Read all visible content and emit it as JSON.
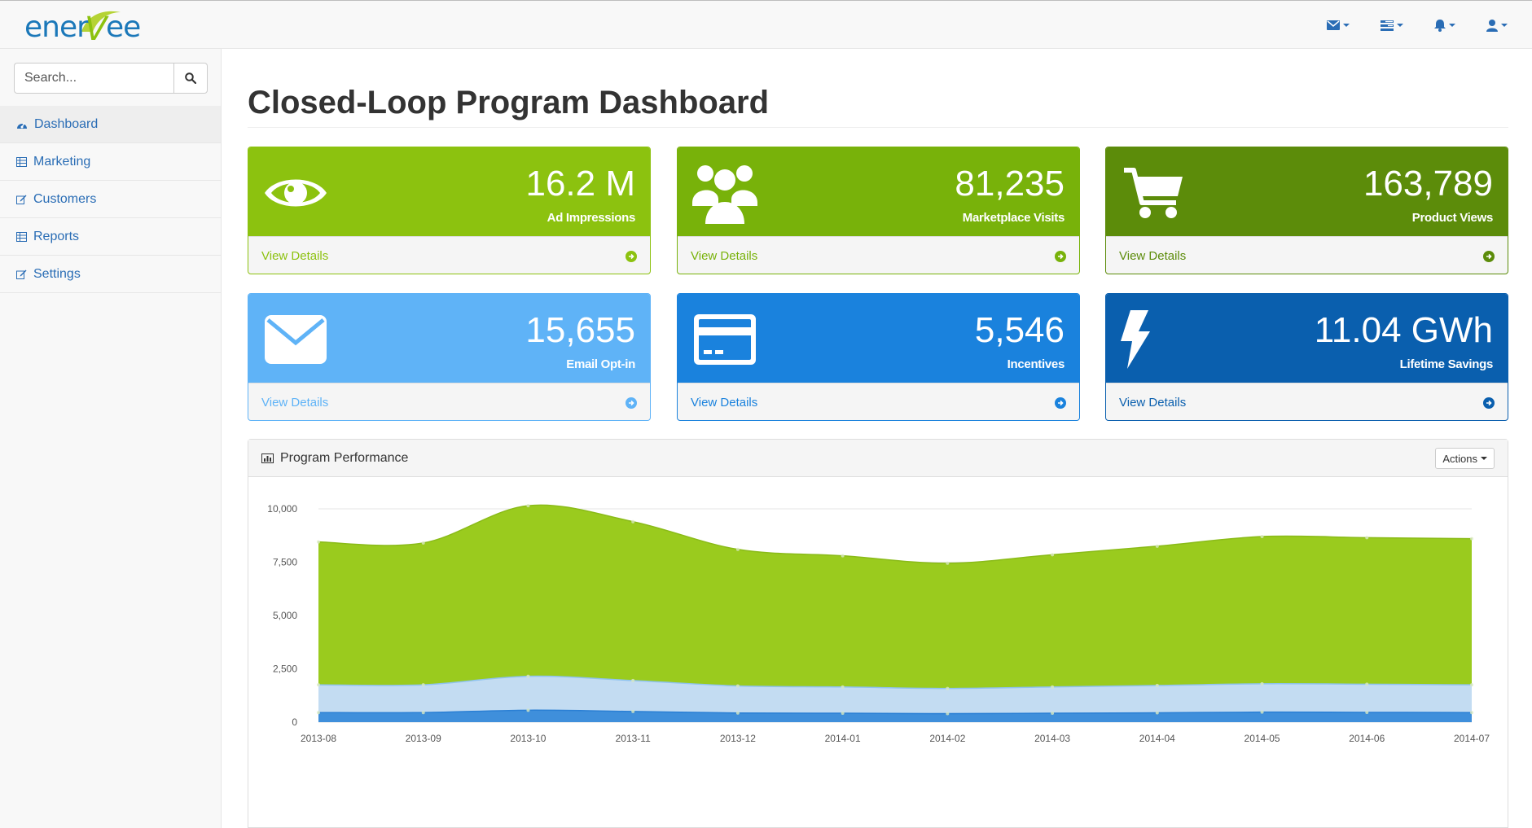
{
  "brand": {
    "logo_text": "enerVee"
  },
  "topbar": {
    "icons": [
      {
        "name": "envelope-icon"
      },
      {
        "name": "tasks-icon"
      },
      {
        "name": "bell-icon"
      },
      {
        "name": "user-icon"
      }
    ]
  },
  "sidebar": {
    "search_placeholder": "Search...",
    "items": [
      {
        "label": "Dashboard",
        "icon": "dashboard-icon",
        "active": true
      },
      {
        "label": "Marketing",
        "icon": "table-icon"
      },
      {
        "label": "Customers",
        "icon": "edit-icon"
      },
      {
        "label": "Reports",
        "icon": "table-icon"
      },
      {
        "label": "Settings",
        "icon": "edit-icon"
      }
    ]
  },
  "page": {
    "title": "Closed-Loop Program Dashboard"
  },
  "panels": [
    {
      "value": "16.2 M",
      "label": "Ad Impressions",
      "link": "View Details",
      "icon": "eye-icon",
      "color": "#8cc20f"
    },
    {
      "value": "81,235",
      "label": "Marketplace Visits",
      "link": "View Details",
      "icon": "users-icon",
      "color": "#78b20a"
    },
    {
      "value": "163,789",
      "label": "Product Views",
      "link": "View Details",
      "icon": "shopping-cart-icon",
      "color": "#5c8c0a"
    },
    {
      "value": "15,655",
      "label": "Email Opt-in",
      "link": "View Details",
      "icon": "envelope-icon",
      "color": "#5fb3f7"
    },
    {
      "value": "5,546",
      "label": "Incentives",
      "link": "View Details",
      "icon": "credit-card-icon",
      "color": "#1a82dd"
    },
    {
      "value": "11.04 GWh",
      "label": "Lifetime Savings",
      "link": "View Details",
      "icon": "bolt-icon",
      "color": "#0a5fae"
    }
  ],
  "chart_panel": {
    "title": "Program Performance",
    "actions_label": "Actions"
  },
  "chart_data": {
    "type": "area",
    "x": [
      "2013-08",
      "2013-09",
      "2013-10",
      "2013-11",
      "2013-12",
      "2014-01",
      "2014-02",
      "2014-03",
      "2014-04",
      "2014-05",
      "2014-06",
      "2014-07"
    ],
    "yticks": [
      "0",
      "2,500",
      "5,000",
      "7,500",
      "10,000"
    ],
    "ylim": [
      0,
      10000
    ],
    "series": [
      {
        "color": "#9acb1e",
        "values": [
          8450,
          8400,
          10150,
          9400,
          8100,
          7800,
          7450,
          7850,
          8250,
          8700,
          8650,
          8600
        ]
      },
      {
        "color": "#c3dcf2",
        "values": [
          1750,
          1750,
          2150,
          1950,
          1700,
          1650,
          1580,
          1650,
          1720,
          1800,
          1780,
          1750
        ]
      },
      {
        "color": "#3f8fdb",
        "values": [
          450,
          450,
          560,
          500,
          430,
          420,
          400,
          420,
          440,
          470,
          460,
          450
        ]
      }
    ],
    "grid": true
  }
}
